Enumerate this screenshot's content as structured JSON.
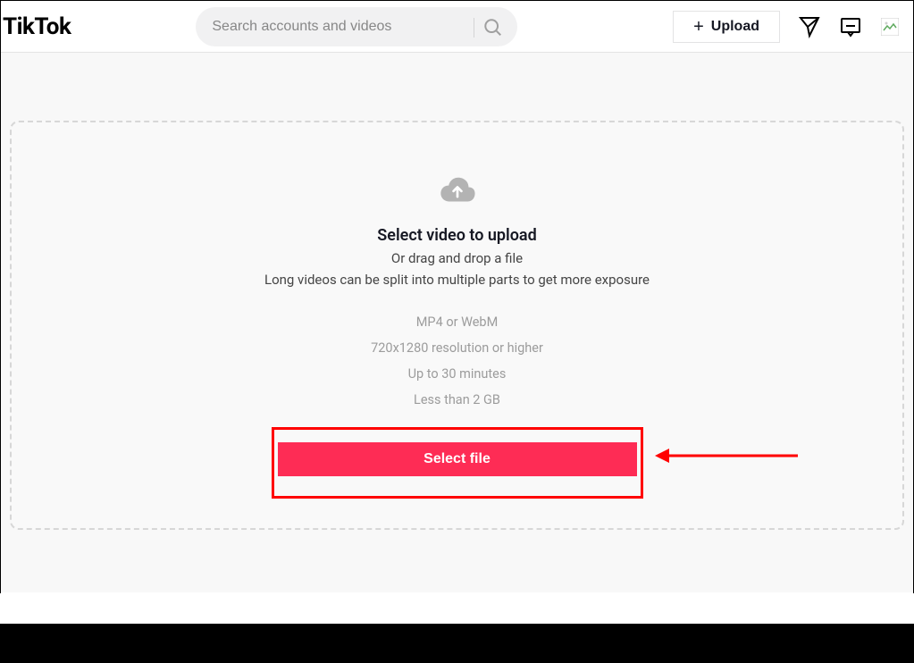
{
  "header": {
    "logo": "TikTok",
    "search_placeholder": "Search accounts and videos",
    "upload_label": "Upload"
  },
  "upload": {
    "title": "Select video to upload",
    "subtitle": "Or drag and drop a file",
    "info": "Long videos can be split into multiple parts to get more exposure",
    "specs": [
      "MP4 or WebM",
      "720x1280 resolution or higher",
      "Up to 30 minutes",
      "Less than 2 GB"
    ],
    "select_button": "Select file"
  }
}
